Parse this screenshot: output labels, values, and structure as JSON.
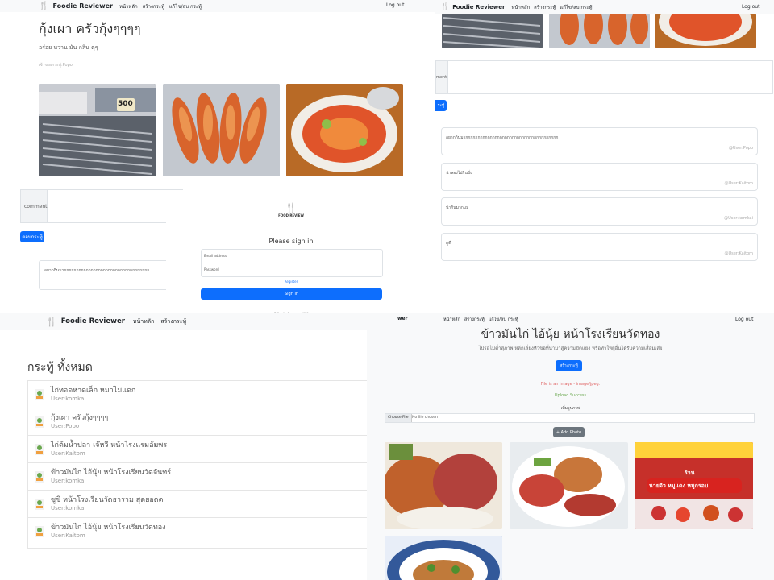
{
  "brand": "Foodie Reviewer",
  "nav_links": [
    "หน้าหลัก",
    "สร้างกระทู้",
    "แก้ไข/ลบ กระทู้"
  ],
  "logout": "Log out",
  "post1": {
    "title": "กุ้งเผา ครัวกุ้งๆๆๆๆ",
    "description": "อร่อย หวาน มัน กลิ่น ตุๆ",
    "owner": "เจ้าของกระทู้:Popo",
    "comment_label": "comment",
    "submit_label": "ตอบกระทู้",
    "first_comment": "อยากกินมากกกกกกกกกกกกกกกกกกกกกกกกกกกกกกกกกกก"
  },
  "post2": {
    "comment_label": "ment",
    "submit_label": "ระทู้",
    "comments": [
      {
        "text": "อยากกินมากกกกกกกกกกกกกกกกกกกกกกกกกกกกกกกกกกกกกก",
        "author": "@User:Popo"
      },
      {
        "text": "น่าลองไปกินมั่ง",
        "author": "@User:Kaitom"
      },
      {
        "text": "น่ากินมากมม",
        "author": "@User:komkai"
      },
      {
        "text": "ดูดี",
        "author": "@User:Kaitom"
      }
    ]
  },
  "login": {
    "logo_text": "FOOD REVIEW",
    "heading": "Please sign in",
    "email_placeholder": "Email address",
    "password_placeholder": "Password",
    "register": "Register",
    "signin": "Sign in",
    "footer": "© Foodie Reviewer 2022"
  },
  "list": {
    "heading": "กระทู้ ทั้งหมด",
    "items": [
      {
        "title": "ไก่ทอดหาดเล็ก หมาไม่แดก",
        "user": "User:komkai"
      },
      {
        "title": "กุ้งเผา ครัวกุ้งๆๆๆๆ",
        "user": "User:Popo"
      },
      {
        "title": "ไก่ต้มน้ำปลา เจ๊หวี หน้าโรงแรมอัมพร",
        "user": "User:Kaitom"
      },
      {
        "title": "ข้าวมันไก่ ไอ้นุ้ย หน้าโรงเรียนวัดจันทร์",
        "user": "User:komkai"
      },
      {
        "title": "ซูชิ หน้าโรงเรียนวัดธาราม สุดยอดด",
        "user": "User:komkai"
      },
      {
        "title": "ข้าวมันไก่ ไอ้นุ้ย หน้าโรงเรียนวัดทอง",
        "user": "User:Kaitom"
      }
    ]
  },
  "upload": {
    "title": "ข้าวมันไก่ ไอ้นุ้ย หน้าโรงเรียนวัดทอง",
    "subtitle": "ไปรอไม่ค่ำสุภาพ หลีกเลี่ยงหัวข้อที่นำมาสู่ความขัดแย้ง หรือทำให้ผู้อื่นได้รับความเสื่อมเสีย",
    "create_button": "สร้างกระทู้",
    "error_text": "File is an image - image/jpeg.",
    "success_text": "Upload Success",
    "add_image_label": "เพิ่มรูปภาพ",
    "choose_file": "Choose File",
    "no_file": "No file chosen",
    "add_photo_button": "+ Add Photo"
  },
  "photo_signs": {
    "sign1": "500",
    "sign2": "ร้าน",
    "sign3": "นายจิว หมูแดง หมูกรอบ"
  },
  "colors": {
    "primary": "#0d6efd",
    "navbar": "#f8f9fa",
    "brand_fork": "#f08c1a",
    "error": "#e06666",
    "success": "#6aa84f"
  }
}
